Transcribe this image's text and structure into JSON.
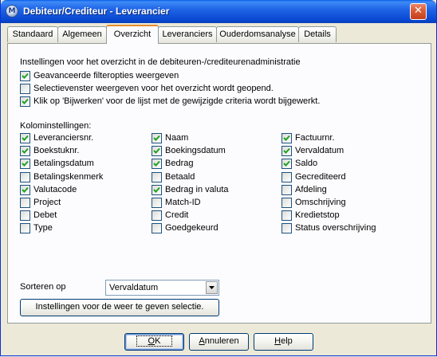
{
  "window": {
    "title": "Debiteur/Crediteur - Leverancier",
    "app_icon_glyph": "M",
    "close_glyph": "✕"
  },
  "tabs": [
    {
      "label": "Standaard",
      "active": false
    },
    {
      "label": "Algemeen",
      "active": false
    },
    {
      "label": "Overzicht",
      "active": true
    },
    {
      "label": "Leveranciers",
      "active": false
    },
    {
      "label": "Ouderdomsanalyse",
      "active": false
    },
    {
      "label": "Details",
      "active": false
    }
  ],
  "overview_settings": {
    "heading": "Instellingen voor het overzicht in de debiteuren-/crediteurenadministratie",
    "options": [
      {
        "label": "Geavanceerde filteropties weergeven",
        "checked": true
      },
      {
        "label": "Selectievenster weergeven voor het overzicht wordt geopend.",
        "checked": false
      },
      {
        "label": "Klik op 'Bijwerken' voor de lijst met de gewijzigde criteria wordt bijgewerkt.",
        "checked": true
      }
    ]
  },
  "columns": {
    "heading": "Kolominstellingen:",
    "col1": [
      {
        "label": "Leveranciersnr.",
        "checked": true
      },
      {
        "label": "Boekstuknr.",
        "checked": true
      },
      {
        "label": "Betalingsdatum",
        "checked": true
      },
      {
        "label": "Betalingskenmerk",
        "checked": false
      },
      {
        "label": "Valutacode",
        "checked": true
      },
      {
        "label": "Project",
        "checked": false
      },
      {
        "label": "Debet",
        "checked": false
      },
      {
        "label": "Type",
        "checked": false
      }
    ],
    "col2": [
      {
        "label": "Naam",
        "checked": true
      },
      {
        "label": "Boekingsdatum",
        "checked": true
      },
      {
        "label": "Bedrag",
        "checked": true
      },
      {
        "label": "Betaald",
        "checked": false
      },
      {
        "label": "Bedrag in valuta",
        "checked": true
      },
      {
        "label": "Match-ID",
        "checked": false
      },
      {
        "label": "Credit",
        "checked": false
      },
      {
        "label": "Goedgekeurd",
        "checked": false
      }
    ],
    "col3": [
      {
        "label": "Factuurnr.",
        "checked": true
      },
      {
        "label": "Vervaldatum",
        "checked": true
      },
      {
        "label": "Saldo",
        "checked": true
      },
      {
        "label": "Gecrediteerd",
        "checked": false
      },
      {
        "label": "Afdeling",
        "checked": false
      },
      {
        "label": "Omschrijving",
        "checked": false
      },
      {
        "label": "Kredietstop",
        "checked": false
      },
      {
        "label": "Status overschrijving",
        "checked": false
      }
    ]
  },
  "sort": {
    "label": "Sorteren op",
    "value": "Vervaldatum"
  },
  "selection_button": "Instellingen voor de weer te geven selectie.",
  "footer": {
    "ok": {
      "label": "OK",
      "mnemonic": "O",
      "rest": "K"
    },
    "cancel": {
      "label": "Annuleren",
      "mnemonic": "A",
      "rest": "nnuleren"
    },
    "help": {
      "label": "Help",
      "mnemonic": "H",
      "rest": "elp"
    }
  },
  "colors": {
    "titlebar": "#0a5fe6",
    "dialog_bg": "#ece9d8",
    "active_tab_accent": "#e68b2c",
    "checkmark": "#21a121"
  }
}
